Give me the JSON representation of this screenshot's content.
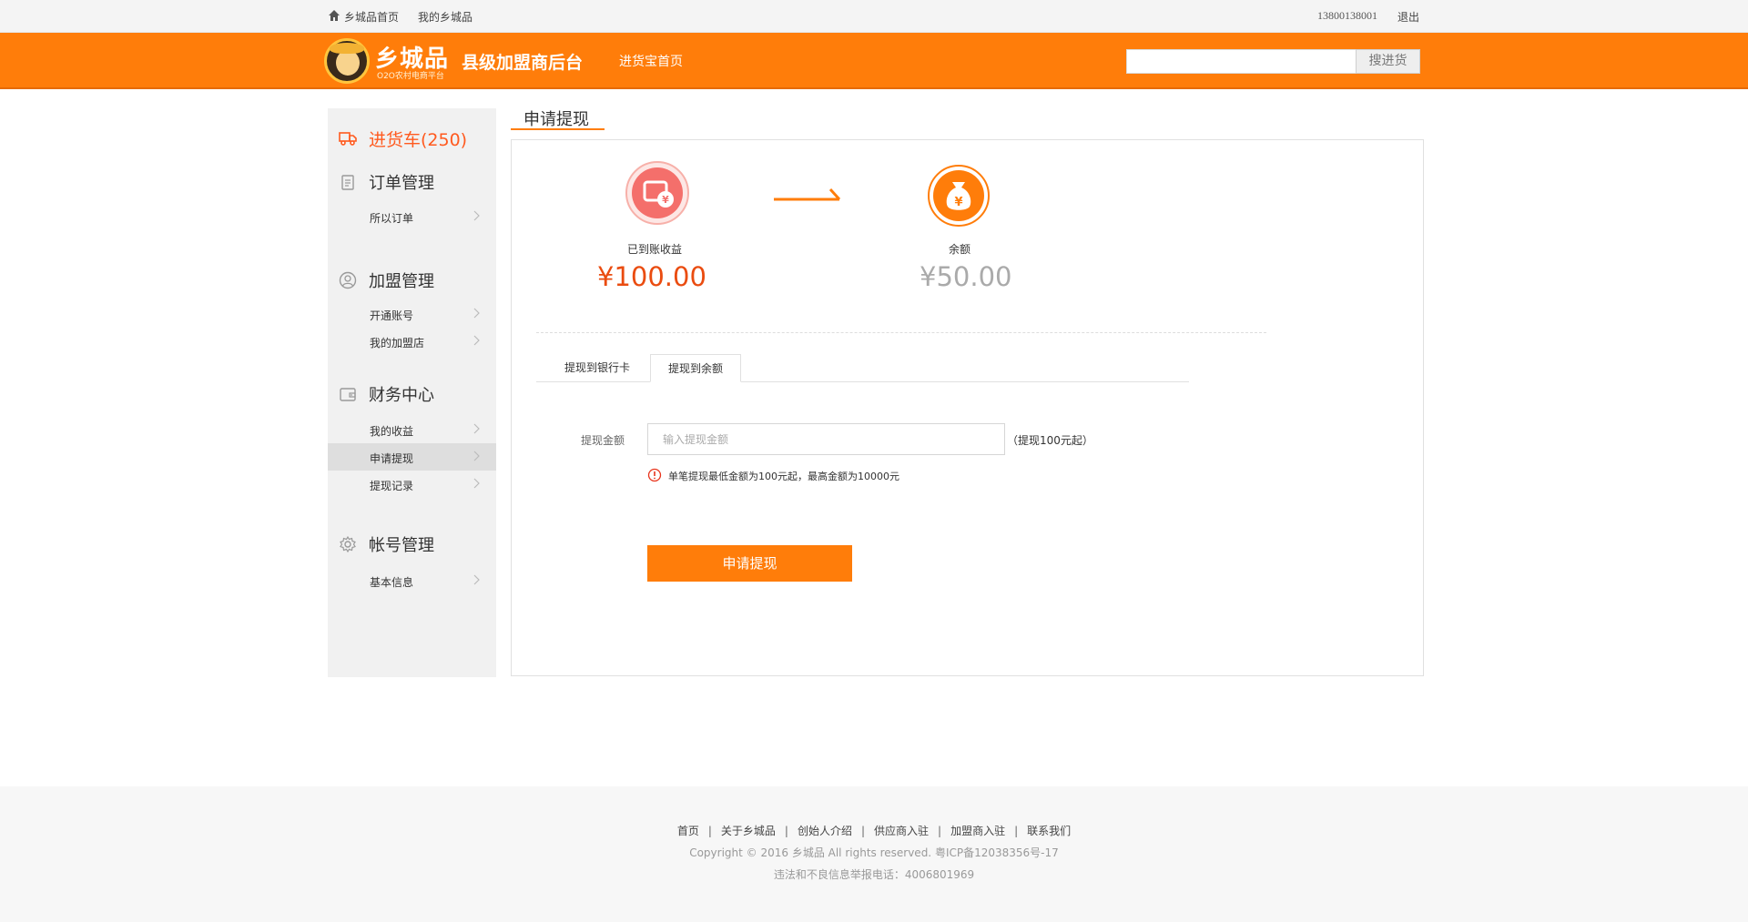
{
  "topbar": {
    "home_link": "乡城品首页",
    "my_link": "我的乡城品",
    "phone": "13800138001",
    "logout": "退出"
  },
  "header": {
    "brand": "乡城品",
    "brand_sub": "O2O农村电商平台",
    "title": "县级加盟商后台",
    "nav_link": "进货宝首页",
    "search_placeholder": "",
    "search_button": "搜进货"
  },
  "sidebar": {
    "cart": "进货车(250)",
    "sections": [
      {
        "title": "订单管理",
        "icon": "clipboard-icon",
        "items": [
          "所以订单"
        ]
      },
      {
        "title": "加盟管理",
        "icon": "user-icon",
        "items": [
          "开通账号",
          "我的加盟店"
        ]
      },
      {
        "title": "财务中心",
        "icon": "wallet-icon",
        "items": [
          "我的收益",
          "申请提现",
          "提现记录"
        ]
      },
      {
        "title": "帐号管理",
        "icon": "gear-icon",
        "items": [
          "基本信息"
        ]
      }
    ],
    "active_item": "申请提现"
  },
  "main": {
    "title": "申请提现",
    "flow": {
      "from_label": "已到账收益",
      "from_amount": "¥100.00",
      "to_label": "余额",
      "to_amount": "¥50.00"
    },
    "tabs": [
      "提现到银行卡",
      "提现到余额"
    ],
    "active_tab": "提现到余额",
    "form": {
      "label": "提现金额",
      "placeholder": "输入提现金额",
      "value": "",
      "hint": "（提现100元起）",
      "warning": "单笔提现最低金额为100元起，最高金额为10000元",
      "submit": "申请提现"
    }
  },
  "footer": {
    "links": [
      "首页",
      "关于乡城品",
      "创始人介绍",
      "供应商入驻",
      "加盟商入驻",
      "联系我们"
    ],
    "copyright": "Copyright © 2016  乡城品   All rights reserved.   粤ICP备12038356号-17",
    "report": "违法和不良信息举报电话：4006801969"
  },
  "colors": {
    "brand_orange": "#ff7d0a",
    "amount_red": "#ea4c10",
    "amount_gray": "#aaaaaa",
    "sidebar_bg": "#f1f1f1"
  }
}
